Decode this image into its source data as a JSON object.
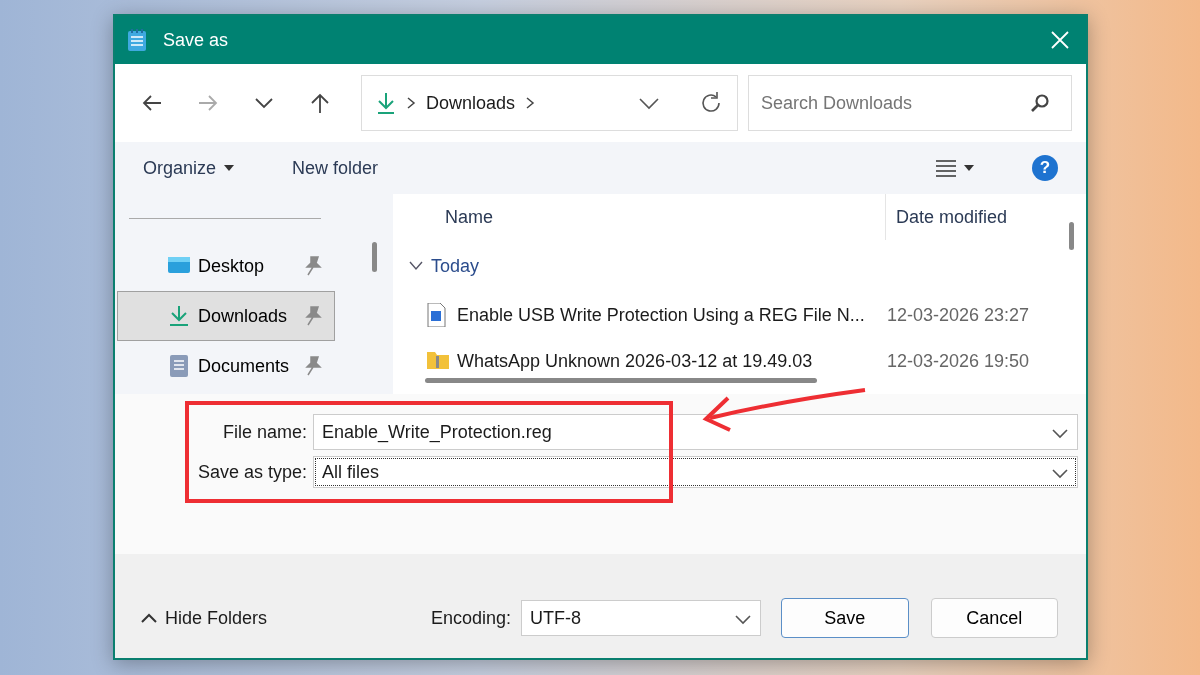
{
  "window": {
    "title": "Save as"
  },
  "navigation": {
    "breadcrumb": [
      {
        "label": "Downloads"
      }
    ],
    "search": {
      "placeholder": "Search Downloads"
    }
  },
  "toolbar": {
    "organize": "Organize",
    "new_folder": "New folder",
    "help": "?"
  },
  "sidebar": {
    "items": [
      {
        "label": "Desktop",
        "kind": "desktop",
        "pinned": true,
        "selected": false
      },
      {
        "label": "Downloads",
        "kind": "download",
        "pinned": true,
        "selected": true
      },
      {
        "label": "Documents",
        "kind": "documents",
        "pinned": true,
        "selected": false
      }
    ]
  },
  "file_list": {
    "columns": [
      "Name",
      "Date modified"
    ],
    "groups": [
      {
        "label": "Today",
        "expanded": true,
        "rows": [
          {
            "kind": "reg",
            "name": "Enable USB Write Protection Using a REG File N...",
            "date": "12-03-2026 23:27"
          },
          {
            "kind": "zip",
            "name": "WhatsApp Unknown 2026-03-12 at 19.49.03",
            "date": "12-03-2026 19:50"
          }
        ]
      }
    ]
  },
  "form": {
    "file_name": {
      "label": "File name:",
      "value": "Enable_Write_Protection.reg"
    },
    "save_as_type": {
      "label": "Save as type:",
      "value": "All files"
    }
  },
  "footer": {
    "hide_folders": "Hide Folders",
    "encoding": {
      "label": "Encoding:",
      "value": "UTF-8"
    },
    "buttons": [
      {
        "label": "Save",
        "primary": true
      },
      {
        "label": "Cancel",
        "primary": false
      }
    ]
  }
}
